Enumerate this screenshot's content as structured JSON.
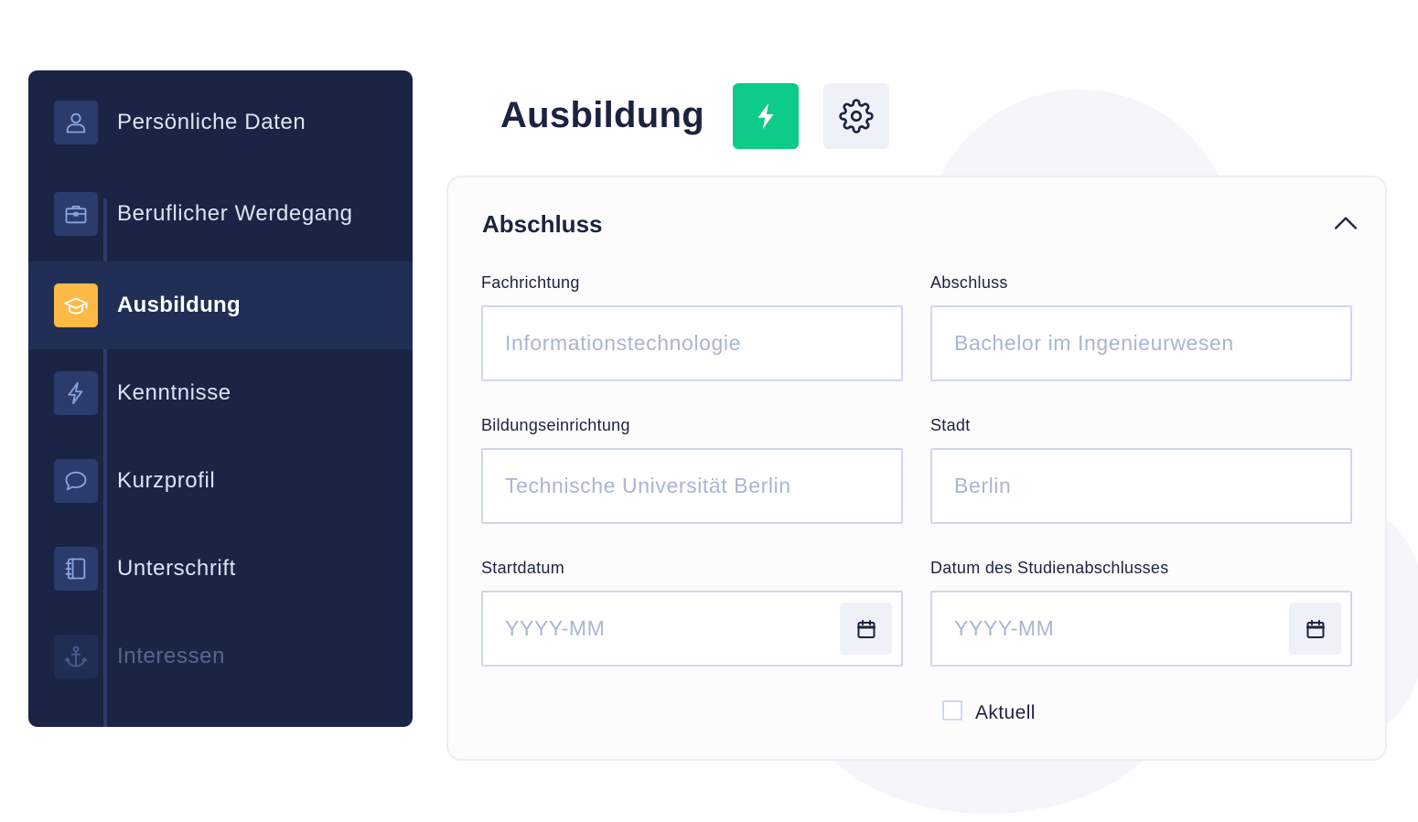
{
  "sidebar": {
    "items": [
      {
        "label": "Persönliche Daten",
        "icon": "user-icon"
      },
      {
        "label": "Beruflicher Werdegang",
        "icon": "briefcase-icon"
      },
      {
        "label": "Ausbildung",
        "icon": "graduation-cap-icon",
        "active": true
      },
      {
        "label": "Kenntnisse",
        "icon": "bolt-icon"
      },
      {
        "label": "Kurzprofil",
        "icon": "speech-bubble-icon"
      },
      {
        "label": "Unterschrift",
        "icon": "notebook-icon"
      },
      {
        "label": "Interessen",
        "icon": "anchor-icon"
      }
    ]
  },
  "header": {
    "title": "Ausbildung",
    "action_icon": "bolt-icon",
    "settings_icon": "gear-icon"
  },
  "card": {
    "title": "Abschluss",
    "fields": {
      "field_of_study": {
        "label": "Fachrichtung",
        "value": "",
        "placeholder": "Informationstechnologie"
      },
      "degree": {
        "label": "Abschluss",
        "value": "",
        "placeholder": "Bachelor im Ingenieurwesen"
      },
      "institution": {
        "label": "Bildungseinrichtung",
        "value": "",
        "placeholder": "Technische Universität Berlin"
      },
      "city": {
        "label": "Stadt",
        "value": "",
        "placeholder": "Berlin"
      },
      "start_date": {
        "label": "Startdatum",
        "value": "",
        "placeholder": "YYYY-MM"
      },
      "graduation_date": {
        "label": "Datum des Studienabschlusses",
        "value": "",
        "placeholder": "YYYY-MM"
      }
    },
    "current": {
      "label": "Aktuell",
      "checked": false
    }
  },
  "colors": {
    "sidebar_bg": "#1a2444",
    "active_item_bg": "#212f56",
    "active_icon_bg": "#fcb945",
    "accent_green": "#0ecb87",
    "text_dark": "#1b2340",
    "placeholder": "#a9b6d2",
    "input_border": "#cfd8ea"
  }
}
